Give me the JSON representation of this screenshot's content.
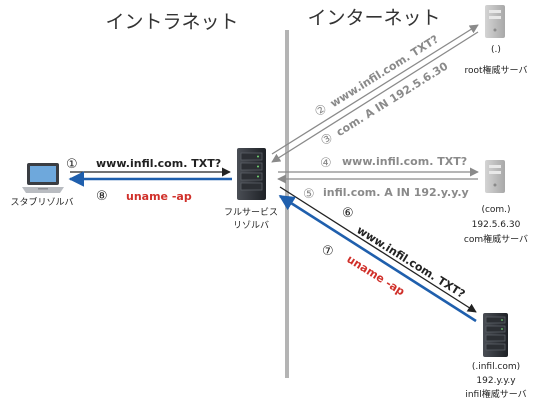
{
  "zones": {
    "intranet": "イントラネット",
    "internet": "インターネット"
  },
  "nodes": {
    "client": {
      "label": "スタブリゾルバ",
      "icon": "laptop-icon"
    },
    "resolver": {
      "label_line1": "フルサービス",
      "label_line2": "リゾルバ",
      "icon": "server-rack-icon"
    },
    "root": {
      "zone": "(.)",
      "label": "root権威サーバ",
      "icon": "server-tower-icon"
    },
    "com": {
      "zone": "(com.)",
      "ip": "192.5.6.30",
      "label": "com権威サーバ",
      "icon": "server-tower-icon"
    },
    "infil": {
      "zone": "(.infil.com)",
      "ip": "192.y.y.y",
      "label": "infil権威サーバ",
      "icon": "server-rack-icon"
    }
  },
  "messages": [
    {
      "step": "①",
      "text": "www.infil.com. TXT?"
    },
    {
      "step": "②",
      "text": "www.infil.com. TXT?"
    },
    {
      "step": "③",
      "text": "com. A IN 192.5.6.30"
    },
    {
      "step": "④",
      "text": "www.infil.com. TXT?"
    },
    {
      "step": "⑤",
      "text": "infil.com. A IN 192.y.y.y"
    },
    {
      "step": "⑥",
      "text": "www.infil.com. TXT?"
    },
    {
      "step": "⑦",
      "text": "uname -ap"
    },
    {
      "step": "⑧",
      "text": "uname -ap"
    }
  ],
  "colors": {
    "blue": "#1f5fad",
    "dark": "#222222",
    "gray": "#8a8a8a",
    "red": "#d0302a",
    "divider": "#b4b4b4"
  }
}
